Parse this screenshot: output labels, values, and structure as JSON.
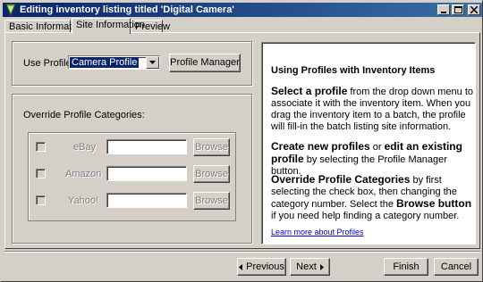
{
  "window": {
    "title": "Editing inventory listing titled 'Digital Camera'"
  },
  "tabs": [
    {
      "label": "Basic Information"
    },
    {
      "label": "Site Information"
    },
    {
      "label": "Preview"
    }
  ],
  "profile": {
    "use_profile_label": "Use Profile",
    "selected_profile": "Camera Profile",
    "profile_manager_label": "Profile Manager"
  },
  "override": {
    "heading": "Override Profile Categories:",
    "rows": [
      {
        "site": "eBay",
        "browse_label": "Browse",
        "value": ""
      },
      {
        "site": "Amazon",
        "browse_label": "Browse",
        "value": ""
      },
      {
        "site": "Yahoo!",
        "browse_label": "Browse",
        "value": ""
      }
    ]
  },
  "help": {
    "heading": "Using Profiles with Inventory Items",
    "p1_bold": "Select a profile",
    "p1_rest": " from the drop down menu to associate it with the inventory item. When you drag the inventory item to a batch, the profile will fill-in the batch listing site information.",
    "p2_bold1": "Create new profiles",
    "p2_mid": " or ",
    "p2_bold2": "edit an existing profile",
    "p2_rest": " by selecting the Profile Manager button.",
    "p3_bold1": "Override Profile Categories",
    "p3_mid": " by first selecting the check box, then changing the category number. Select the ",
    "p3_bold2": "Browse button",
    "p3_rest": " if you need help finding a category number.",
    "link": "Learn more about Profiles"
  },
  "footer": {
    "previous_label": "Previous",
    "next_label": "Next",
    "finish_label": "Finish",
    "cancel_label": "Cancel"
  },
  "colors": {
    "titlebar_start": "#0a246a",
    "titlebar_end": "#3a6ea5",
    "face": "#d4d0c8",
    "link": "#0000cc"
  }
}
